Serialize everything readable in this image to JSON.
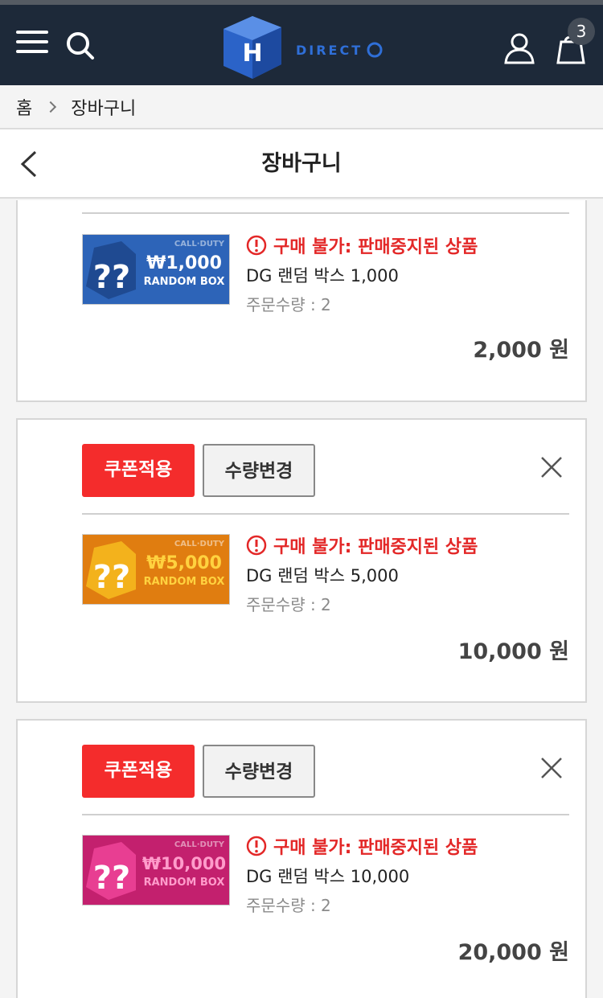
{
  "header": {
    "logo_text": "DIRECT",
    "cart_count": "3"
  },
  "breadcrumb": {
    "home": "홈",
    "current": "장바구니"
  },
  "page": {
    "title": "장바구니"
  },
  "labels": {
    "coupon_button": "쿠폰적용",
    "quantity_button": "수량변경",
    "unavailable": "구매 불가: 판매중지된 상품",
    "qty_prefix": "주문수량 : "
  },
  "items": [
    {
      "name": "DG 랜덤 박스 1,000",
      "quantity": "주문수량 : 2",
      "price": "2,000 원",
      "thumb_value": "₩1,000",
      "thumb_color": "#2d64b8"
    },
    {
      "name": "DG 랜덤 박스 5,000",
      "quantity": "주문수량 : 2",
      "price": "10,000 원",
      "thumb_value": "₩5,000",
      "thumb_color": "#e07d10"
    },
    {
      "name": "DG 랜덤 박스 10,000",
      "quantity": "주문수량 : 2",
      "price": "20,000 원",
      "thumb_value": "₩10,000",
      "thumb_color": "#c3206e"
    }
  ],
  "thumb_common": {
    "caption": "RANDOM BOX",
    "brand": "CALL·DUTY",
    "mark": "??"
  }
}
